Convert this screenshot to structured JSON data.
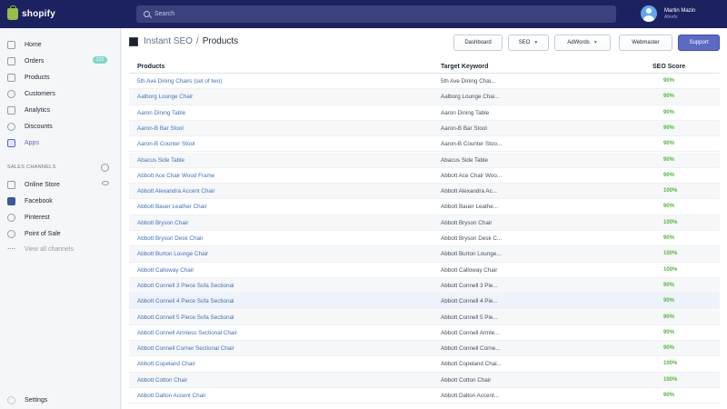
{
  "topbar": {
    "brand": "shopify",
    "search_placeholder": "Search",
    "user_name": "Martin Mazin",
    "user_store": "Ahrefs"
  },
  "sidebar": {
    "items": [
      {
        "label": "Home",
        "icon": "home-icon"
      },
      {
        "label": "Orders",
        "icon": "orders-icon",
        "badge": "123"
      },
      {
        "label": "Products",
        "icon": "tag-icon"
      },
      {
        "label": "Customers",
        "icon": "customers-icon"
      },
      {
        "label": "Analytics",
        "icon": "analytics-icon"
      },
      {
        "label": "Discounts",
        "icon": "discount-icon"
      },
      {
        "label": "Apps",
        "icon": "apps-icon"
      }
    ],
    "channels_title": "SALES CHANNELS",
    "channels": [
      {
        "label": "Online Store",
        "icon": "store-icon"
      },
      {
        "label": "Facebook",
        "icon": "facebook-icon"
      },
      {
        "label": "Pinterest",
        "icon": "pinterest-icon"
      },
      {
        "label": "Point of Sale",
        "icon": "pos-icon"
      },
      {
        "label": "View all channels",
        "icon": "more-icon"
      }
    ],
    "settings_label": "Settings"
  },
  "header": {
    "app_name": "Instant SEO",
    "separator": "/",
    "page": "Products",
    "buttons": {
      "dashboard": "Dashboard",
      "seo": "SEO",
      "adwords": "AdWords",
      "webmaster": "Webmaster",
      "support": "Support"
    }
  },
  "table": {
    "columns": [
      "Products",
      "Target Keyword",
      "SEO Score"
    ],
    "rows": [
      {
        "product": "5th Ave Dining Chairs (set of two)",
        "keyword": "5th Ave Dining Chai...",
        "score": "90%"
      },
      {
        "product": "Aalborg Lounge Chair",
        "keyword": "Aalborg Lounge Chai...",
        "score": "90%"
      },
      {
        "product": "Aaron Dining Table",
        "keyword": "Aaron Dining Table",
        "score": "90%"
      },
      {
        "product": "Aaron-B Bar Stool",
        "keyword": "Aaron-B Bar Stool",
        "score": "90%"
      },
      {
        "product": "Aaron-B Counter Stool",
        "keyword": "Aaron-B Counter Stoo...",
        "score": "90%"
      },
      {
        "product": "Abacus Side Table",
        "keyword": "Abacus Side Table",
        "score": "90%"
      },
      {
        "product": "Abbott Ace Chair Wood Frame",
        "keyword": "Abbott Ace Chair Woo...",
        "score": "90%"
      },
      {
        "product": "Abbott Alexandra Accent Chair",
        "keyword": "Abbott Alexandra Ac...",
        "score": "100%"
      },
      {
        "product": "Abbott Bauer Leather Chair",
        "keyword": "Abbott Bauer Leathe...",
        "score": "90%"
      },
      {
        "product": "Abbott Bryson Chair",
        "keyword": "Abbott Bryson Chair",
        "score": "100%"
      },
      {
        "product": "Abbott Bryson Desk Chair",
        "keyword": "Abbott Bryson Desk C...",
        "score": "90%"
      },
      {
        "product": "Abbott Burton Lounge Chair",
        "keyword": "Abbott Burton Lounge...",
        "score": "100%"
      },
      {
        "product": "Abbott Calloway Chair",
        "keyword": "Abbott Calloway Chair",
        "score": "100%"
      },
      {
        "product": "Abbott Connell 3 Piece Sofa Sectional",
        "keyword": "Abbott Connell 3 Pie...",
        "score": "90%"
      },
      {
        "product": "Abbott Connell 4 Piece Sofa Sectional",
        "keyword": "Abbott Connell 4 Pie...",
        "score": "90%"
      },
      {
        "product": "Abbott Connell 5 Piece Sofa Sectional",
        "keyword": "Abbott Connell 5 Pie...",
        "score": "90%"
      },
      {
        "product": "Abbott Connell Armless Sectional Chair",
        "keyword": "Abbott Connell Armle...",
        "score": "90%"
      },
      {
        "product": "Abbott Connell Corner Sectional Chair",
        "keyword": "Abbott Connell Corne...",
        "score": "90%"
      },
      {
        "product": "Abbott Copeland Chair",
        "keyword": "Abbott Copeland Chai...",
        "score": "100%"
      },
      {
        "product": "Abbott Cotton Chair",
        "keyword": "Abbott Cotton Chair",
        "score": "100%"
      },
      {
        "product": "Abbott Dalton Accent Chair",
        "keyword": "Abbott Dalton Accent...",
        "score": "90%"
      }
    ]
  }
}
